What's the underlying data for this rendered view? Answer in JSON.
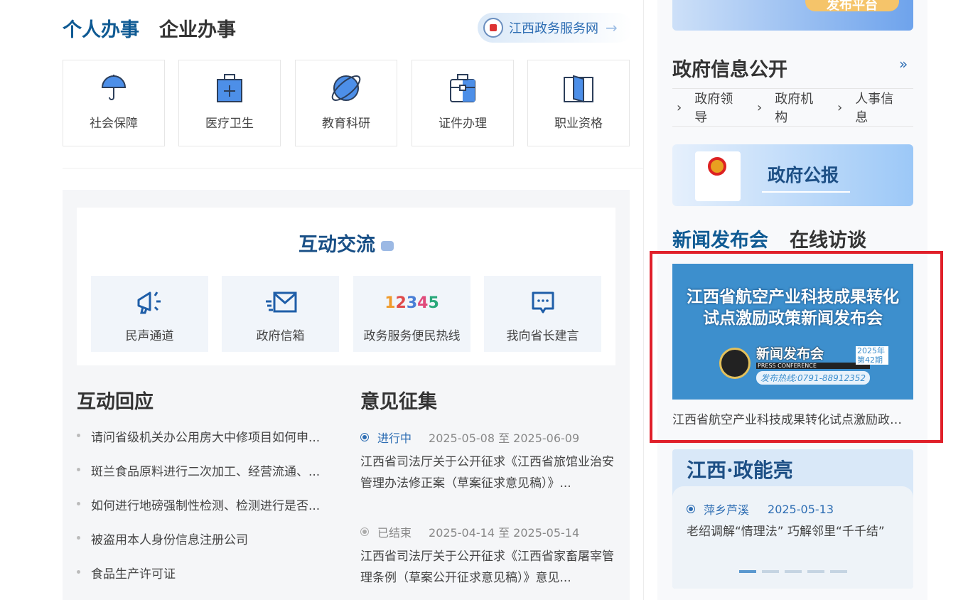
{
  "main_tabs": [
    "个人办事",
    "企业办事"
  ],
  "portal_link": "江西政务服务网",
  "services": [
    {
      "label": "社会保障",
      "icon": "umbrella-icon"
    },
    {
      "label": "医疗卫生",
      "icon": "medical-kit-icon"
    },
    {
      "label": "教育科研",
      "icon": "planet-icon"
    },
    {
      "label": "证件办理",
      "icon": "briefcase-icon"
    },
    {
      "label": "职业资格",
      "icon": "book-icon"
    }
  ],
  "interaction": {
    "title": "互动交流",
    "items": [
      {
        "label": "民声通道",
        "icon": "megaphone-icon"
      },
      {
        "label": "政府信箱",
        "icon": "mail-icon"
      },
      {
        "label": "政务服务便民热线",
        "icon": "12345"
      },
      {
        "label": "我向省长建言",
        "icon": "chat-icon"
      }
    ]
  },
  "responses": {
    "title": "互动回应",
    "items": [
      "请问省级机关办公用房大中修项目如何申...",
      "斑兰食品原料进行二次加工、经营流通、...",
      "如何进行地磅强制性检测、检测进行是否...",
      "被盗用本人身份信息注册公司",
      "食品生产许可证"
    ]
  },
  "opinions": {
    "title": "意见征集",
    "items": [
      {
        "status": "进行中",
        "dates": "2025-05-08 至 2025-06-09",
        "text": "江西省司法厅关于公开征求《江西省旅馆业治安管理办法修正案（草案征求意见稿）》..."
      },
      {
        "status": "已结束",
        "dates": "2025-04-14 至 2025-05-14",
        "text": "江西省司法厅关于公开征求《江西省家畜屠宰管理条例（草案公开征求意见稿）》意见..."
      }
    ]
  },
  "right": {
    "top_banner": "发布平台",
    "gov_info": {
      "title": "政府信息公开",
      "more": "»",
      "links": [
        "政府领导",
        "政府机构",
        "人事信息"
      ]
    },
    "gazette": "政府公报",
    "news_tabs": [
      "新闻发布会",
      "在线访谈"
    ],
    "news": {
      "image_title_1": "江西省航空产业科技成果转化",
      "image_title_2": "试点激励政策新闻发布会",
      "brand": "新闻发布会",
      "brand_en": "PRESS CONFERENCE",
      "year": "2025年",
      "issue": "第42期",
      "hotline": "发布热线:0791-88912352",
      "caption": "江西省航空产业科技成果转化试点激励政策新闻发布会"
    },
    "zhengnengliang": {
      "title": "江西·政能亮",
      "source": "萍乡芦溪",
      "date": "2025-05-13",
      "text": "老绍调解“情理法” 巧解邻里“千千结”",
      "slides": 5,
      "active_slide": 1
    }
  },
  "colors": {
    "accent": "#0f5a93",
    "highlight": "#e0202a"
  }
}
